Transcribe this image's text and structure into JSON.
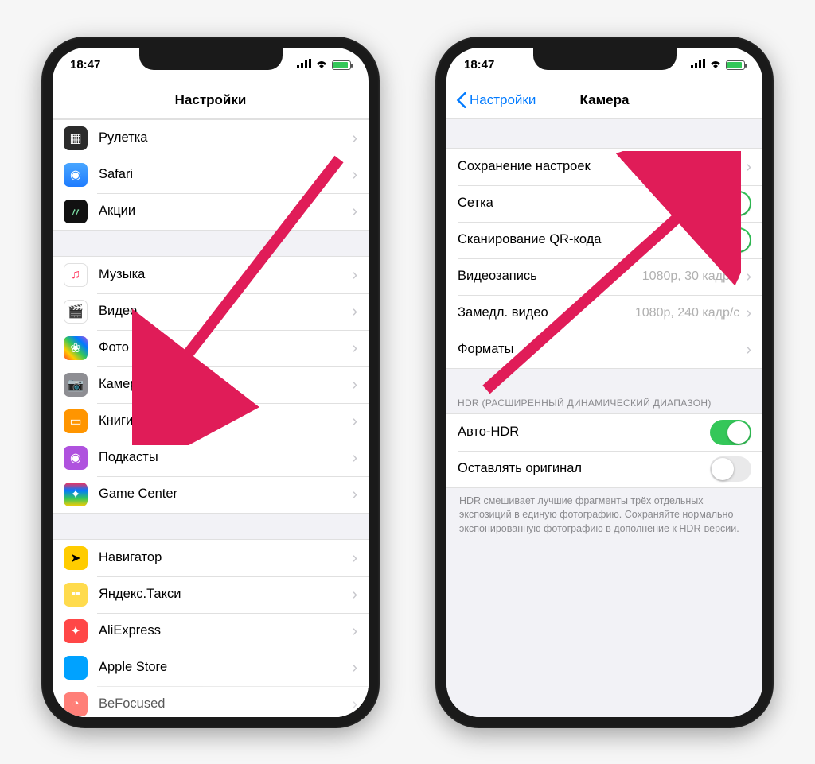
{
  "status": {
    "time": "18:47"
  },
  "colors": {
    "toggle_on": "#34c759",
    "accent": "#007aff",
    "arrow": "#e01c58"
  },
  "left": {
    "title": "Настройки",
    "group1": [
      {
        "icon": "ruletka-icon",
        "label": "Рулетка"
      },
      {
        "icon": "safari-icon",
        "label": "Safari"
      },
      {
        "icon": "stocks-icon",
        "label": "Акции"
      }
    ],
    "group2": [
      {
        "icon": "music-icon",
        "label": "Музыка"
      },
      {
        "icon": "video-icon",
        "label": "Видео"
      },
      {
        "icon": "photo-icon",
        "label": "Фото"
      },
      {
        "icon": "camera-icon",
        "label": "Камера"
      },
      {
        "icon": "books-icon",
        "label": "Книги"
      },
      {
        "icon": "podcasts-icon",
        "label": "Подкасты"
      },
      {
        "icon": "gamecenter-icon",
        "label": "Game Center"
      }
    ],
    "group3": [
      {
        "icon": "navigator-icon",
        "label": "Навигатор"
      },
      {
        "icon": "yandextaxi-icon",
        "label": "Яндекс.Такси"
      },
      {
        "icon": "aliexpress-icon",
        "label": "AliExpress"
      },
      {
        "icon": "applestore-icon",
        "label": "Apple Store"
      },
      {
        "icon": "befocused-icon",
        "label": "BeFocused"
      }
    ]
  },
  "right": {
    "back": "Настройки",
    "title": "Камера",
    "rows": {
      "preserve": {
        "label": "Сохранение настроек"
      },
      "grid": {
        "label": "Сетка",
        "on": true
      },
      "qr": {
        "label": "Сканирование QR-кода",
        "on": true
      },
      "video": {
        "label": "Видеозапись",
        "value": "1080p, 30 кадр/с"
      },
      "slomo": {
        "label": "Замедл. видео",
        "value": "1080p, 240 кадр/с"
      },
      "formats": {
        "label": "Форматы"
      }
    },
    "hdr_header": "HDR (РАСШИРЕННЫЙ ДИНАМИЧЕСКИЙ ДИАПАЗОН)",
    "hdr_rows": {
      "auto": {
        "label": "Авто-HDR",
        "on": true
      },
      "keep": {
        "label": "Оставлять оригинал",
        "on": false
      }
    },
    "hdr_footer": "HDR смешивает лучшие фрагменты трёх отдельных экспозиций в единую фотографию. Сохраняйте нормально экспонированную фотографию в дополнение к HDR-версии."
  }
}
